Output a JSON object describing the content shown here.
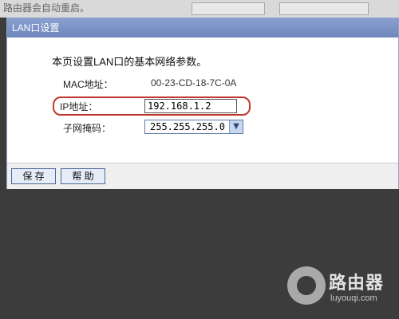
{
  "background": {
    "top_text": "路由器会自动重启。"
  },
  "panel": {
    "title": "LAN口设置",
    "description": "本页设置LAN口的基本网络参数。",
    "fields": {
      "mac_label": "MAC地址：",
      "mac_value": "00-23-CD-18-7C-0A",
      "ip_label": "IP地址：",
      "ip_value": "192.168.1.2",
      "mask_label": "子网掩码：",
      "mask_value": "255.255.255.0"
    },
    "buttons": {
      "save": "保 存",
      "help": "帮 助"
    },
    "colors": {
      "highlight": "#c0372f"
    }
  },
  "watermark": {
    "title": "路由器",
    "subtitle": "luyouqi.com"
  }
}
